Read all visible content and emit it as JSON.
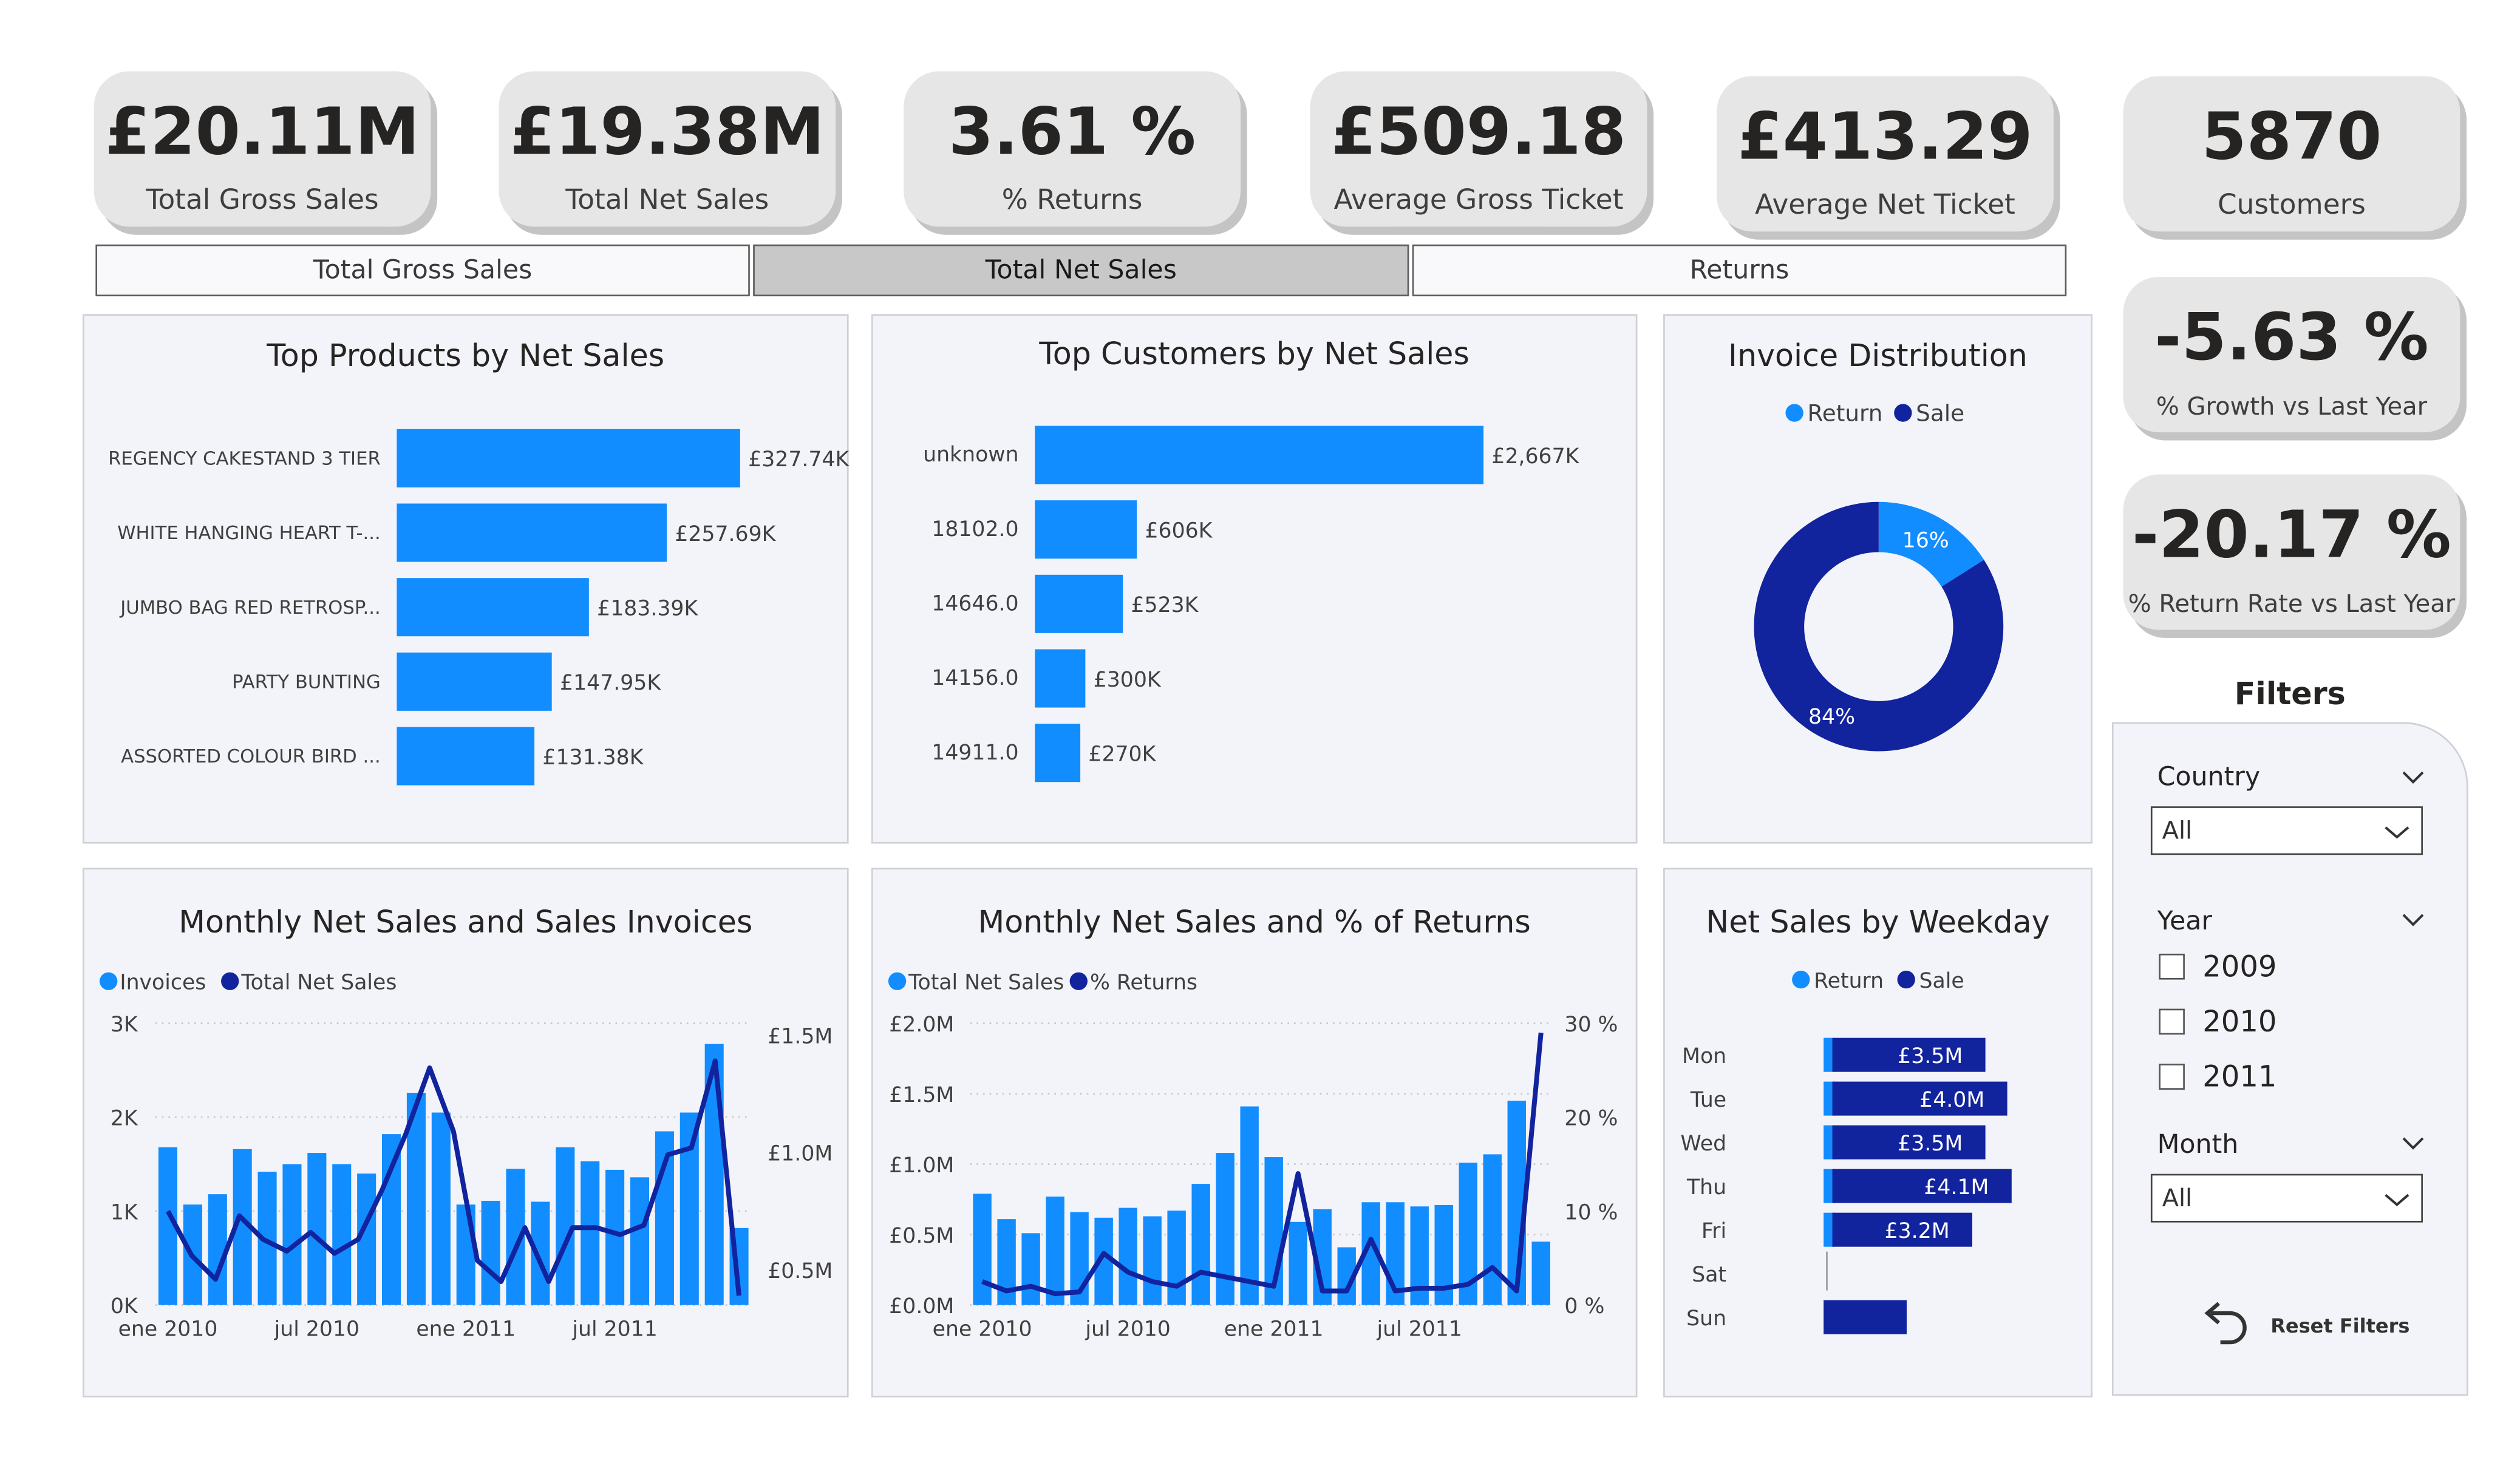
{
  "kpis": [
    {
      "value": "£20.11M",
      "label": "Total Gross Sales"
    },
    {
      "value": "£19.38M",
      "label": "Total Net Sales"
    },
    {
      "value": "3.61 %",
      "label": "% Returns"
    },
    {
      "value": "£509.18",
      "label": "Average Gross Ticket"
    },
    {
      "value": "£413.29",
      "label": "Average Net Ticket"
    },
    {
      "value": "5870",
      "label": "Customers"
    }
  ],
  "side_kpis": [
    {
      "value": "-5.63 %",
      "label": "% Growth vs Last Year"
    },
    {
      "value": "-20.17 %",
      "label": "% Return Rate vs Last Year"
    }
  ],
  "tabs": [
    {
      "label": "Total Gross Sales",
      "active": false
    },
    {
      "label": "Total Net Sales",
      "active": true
    },
    {
      "label": "Returns",
      "active": false
    }
  ],
  "colors": {
    "light_blue": "#118dff",
    "dark_blue": "#12239e",
    "panel_bg": "#f3f4f9"
  },
  "filters": {
    "title": "Filters",
    "country_label": "Country",
    "country_value": "All",
    "year_label": "Year",
    "years": [
      "2009",
      "2010",
      "2011"
    ],
    "month_label": "Month",
    "month_value": "All",
    "reset_label": "Reset Filters",
    "reset_icon": "undo-arrow-icon"
  },
  "chart_data": [
    {
      "id": "top_products",
      "type": "bar",
      "orientation": "horizontal",
      "title": "Top Products by Net Sales",
      "categories": [
        "REGENCY CAKESTAND 3 TIER",
        "WHITE HANGING HEART T-...",
        "JUMBO BAG RED RETROSP...",
        "PARTY BUNTING",
        "ASSORTED COLOUR BIRD ..."
      ],
      "values": [
        327.74,
        257.69,
        183.39,
        147.95,
        131.38
      ],
      "data_labels": [
        "£327.74K",
        "£257.69K",
        "£183.39K",
        "£147.95K",
        "£131.38K"
      ],
      "unit": "£K"
    },
    {
      "id": "top_customers",
      "type": "bar",
      "orientation": "horizontal",
      "title": "Top Customers by Net Sales",
      "categories": [
        "unknown",
        "18102.0",
        "14646.0",
        "14156.0",
        "14911.0"
      ],
      "values": [
        2667,
        606,
        523,
        300,
        270
      ],
      "data_labels": [
        "£2,667K",
        "£606K",
        "£523K",
        "£300K",
        "£270K"
      ],
      "unit": "£K"
    },
    {
      "id": "invoice_distribution",
      "type": "pie",
      "donut": true,
      "title": "Invoice Distribution",
      "legend": [
        "Return",
        "Sale"
      ],
      "values": [
        16,
        84
      ],
      "data_labels": [
        "16%",
        "84%"
      ]
    },
    {
      "id": "monthly_sales_invoices",
      "type": "bar",
      "combo": "bar+line",
      "title": "Monthly Net Sales and Sales Invoices",
      "legend": [
        "Invoices",
        "Total Net Sales"
      ],
      "x_tick_labels": [
        "ene 2010",
        "jul 2010",
        "ene 2011",
        "jul 2011"
      ],
      "y_left_ticks": [
        "0K",
        "1K",
        "2K",
        "3K"
      ],
      "y_right_ticks": [
        "£0.5M",
        "£1.0M",
        "£1.5M"
      ],
      "y_left_range": [
        0,
        3000
      ],
      "y_right_range": [
        0.35,
        1.55
      ],
      "series": [
        {
          "name": "Invoices",
          "axis": "left",
          "values": [
            1680,
            1070,
            1180,
            1660,
            1420,
            1500,
            1620,
            1500,
            1400,
            1820,
            2260,
            2050,
            1070,
            1110,
            1450,
            1100,
            1680,
            1530,
            1440,
            1360,
            1850,
            2050,
            2780,
            820
          ]
        },
        {
          "name": "Total Net Sales",
          "axis": "right",
          "values": [
            0.75,
            0.56,
            0.46,
            0.73,
            0.63,
            0.58,
            0.66,
            0.57,
            0.63,
            0.84,
            1.08,
            1.36,
            1.09,
            0.54,
            0.45,
            0.68,
            0.45,
            0.68,
            0.68,
            0.65,
            0.69,
            0.99,
            1.02,
            1.39,
            0.39
          ]
        }
      ]
    },
    {
      "id": "monthly_sales_returns",
      "type": "bar",
      "combo": "bar+line",
      "title": "Monthly Net Sales and % of Returns",
      "legend": [
        "Total Net Sales",
        "% Returns"
      ],
      "x_tick_labels": [
        "ene 2010",
        "jul 2010",
        "ene 2011",
        "jul 2011"
      ],
      "y_left_ticks": [
        "£0.0M",
        "£0.5M",
        "£1.0M",
        "£1.5M",
        "£2.0M"
      ],
      "y_right_ticks": [
        "0 %",
        "10 %",
        "20 %",
        "30 %"
      ],
      "y_left_range": [
        0,
        2.0
      ],
      "y_right_range": [
        0,
        30
      ],
      "series": [
        {
          "name": "Total Net Sales",
          "axis": "left",
          "values": [
            0.79,
            0.61,
            0.51,
            0.77,
            0.66,
            0.62,
            0.69,
            0.63,
            0.67,
            0.86,
            1.08,
            1.41,
            1.05,
            0.59,
            0.68,
            0.41,
            0.73,
            0.73,
            0.7,
            0.71,
            1.01,
            1.07,
            1.45,
            0.45
          ]
        },
        {
          "name": "% Returns",
          "axis": "right",
          "values": [
            2.5,
            1.5,
            2.0,
            1.2,
            1.4,
            5.5,
            3.5,
            2.5,
            2.0,
            3.5,
            3.0,
            2.5,
            2.0,
            14.0,
            1.5,
            1.5,
            7.0,
            1.5,
            1.8,
            1.8,
            2.2,
            4.0,
            1.5,
            29.0
          ]
        }
      ]
    },
    {
      "id": "weekday_sales",
      "type": "bar",
      "orientation": "horizontal",
      "stacked": true,
      "title": "Net Sales by Weekday",
      "legend": [
        "Return",
        "Sale"
      ],
      "categories": [
        "Mon",
        "Tue",
        "Wed",
        "Thu",
        "Fri",
        "Sat",
        "Sun"
      ],
      "series": [
        {
          "name": "Return",
          "values": [
            0.1,
            0.1,
            0.1,
            0.1,
            0.1,
            0.0,
            0.0
          ]
        },
        {
          "name": "Sale",
          "values": [
            3.5,
            4.0,
            3.5,
            4.1,
            3.2,
            0.0,
            1.9
          ]
        }
      ],
      "data_labels": [
        "£3.5M",
        "£4.0M",
        "£3.5M",
        "£4.1M",
        "£3.2M",
        "",
        ""
      ],
      "unit": "£M"
    }
  ]
}
